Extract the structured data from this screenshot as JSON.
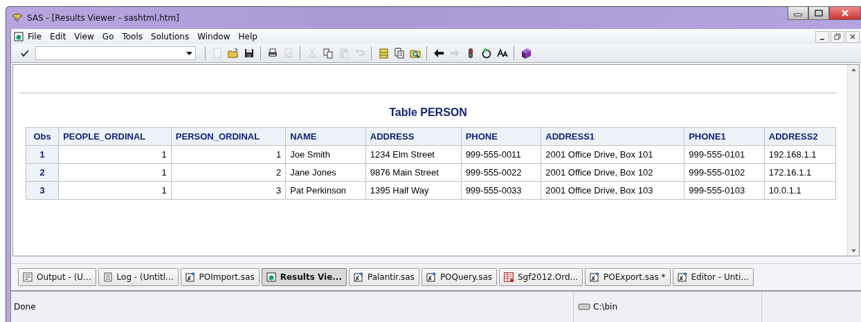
{
  "window": {
    "title": "SAS - [Results Viewer - sashtml.htm]"
  },
  "menu": [
    "File",
    "Edit",
    "View",
    "Go",
    "Tools",
    "Solutions",
    "Window",
    "Help"
  ],
  "toolbar": {
    "groups": [
      [
        {
          "kind": "new",
          "disabled": true
        },
        {
          "kind": "open",
          "disabled": false
        },
        {
          "kind": "save",
          "disabled": false
        }
      ],
      [
        {
          "kind": "print",
          "disabled": false
        },
        {
          "kind": "preview",
          "disabled": true
        }
      ],
      [
        {
          "kind": "cut",
          "disabled": true
        },
        {
          "kind": "copy",
          "disabled": false
        },
        {
          "kind": "paste",
          "disabled": true
        },
        {
          "kind": "undo",
          "disabled": true
        }
      ],
      [
        {
          "kind": "cabinet",
          "disabled": false
        },
        {
          "kind": "document",
          "disabled": false
        },
        {
          "kind": "find",
          "disabled": false
        }
      ],
      [
        {
          "kind": "back",
          "disabled": false
        },
        {
          "kind": "forward",
          "disabled": true
        },
        {
          "kind": "stop",
          "disabled": false
        },
        {
          "kind": "refresh",
          "disabled": false
        },
        {
          "kind": "font",
          "disabled": false
        }
      ],
      [
        {
          "kind": "help",
          "disabled": false
        }
      ]
    ]
  },
  "report": {
    "title": "Table PERSON",
    "table": {
      "columns": [
        "Obs",
        "PEOPLE_ORDINAL",
        "PERSON_ORDINAL",
        "NAME",
        "ADDRESS",
        "PHONE",
        "ADDRESS1",
        "PHONE1",
        "ADDRESS2"
      ],
      "rows": [
        [
          "1",
          "1",
          "1",
          "Joe Smith",
          "1234 Elm Street",
          "999-555-0011",
          "2001 Office Drive, Box 101",
          "999-555-0101",
          "192.168.1.1"
        ],
        [
          "2",
          "1",
          "2",
          "Jane Jones",
          "9876 Main Street",
          "999-555-0022",
          "2001 Office Drive, Box 102",
          "999-555-0102",
          "172.16.1.1"
        ],
        [
          "3",
          "1",
          "3",
          "Pat Perkinson",
          "1395 Half Way",
          "999-555-0033",
          "2001 Office Drive, Box 103",
          "999-555-0103",
          "10.0.1.1"
        ]
      ]
    }
  },
  "window_tabs": [
    {
      "label": "Output - (U...",
      "kind": "output",
      "selected": false
    },
    {
      "label": "Log - (Untitl...",
      "kind": "log",
      "selected": false
    },
    {
      "label": "POImport.sas",
      "kind": "program",
      "selected": false
    },
    {
      "label": "Results Vie...",
      "kind": "results",
      "selected": true
    },
    {
      "label": "Palantir.sas",
      "kind": "program",
      "selected": false
    },
    {
      "label": "POQuery.sas",
      "kind": "program",
      "selected": false
    },
    {
      "label": "Sgf2012.Ord...",
      "kind": "table",
      "selected": false
    },
    {
      "label": "POExport.sas *",
      "kind": "program",
      "selected": false
    },
    {
      "label": "Editor - Unti...",
      "kind": "program",
      "selected": false
    }
  ],
  "status_bar": {
    "message": "Done",
    "path": "C:\\bin"
  }
}
